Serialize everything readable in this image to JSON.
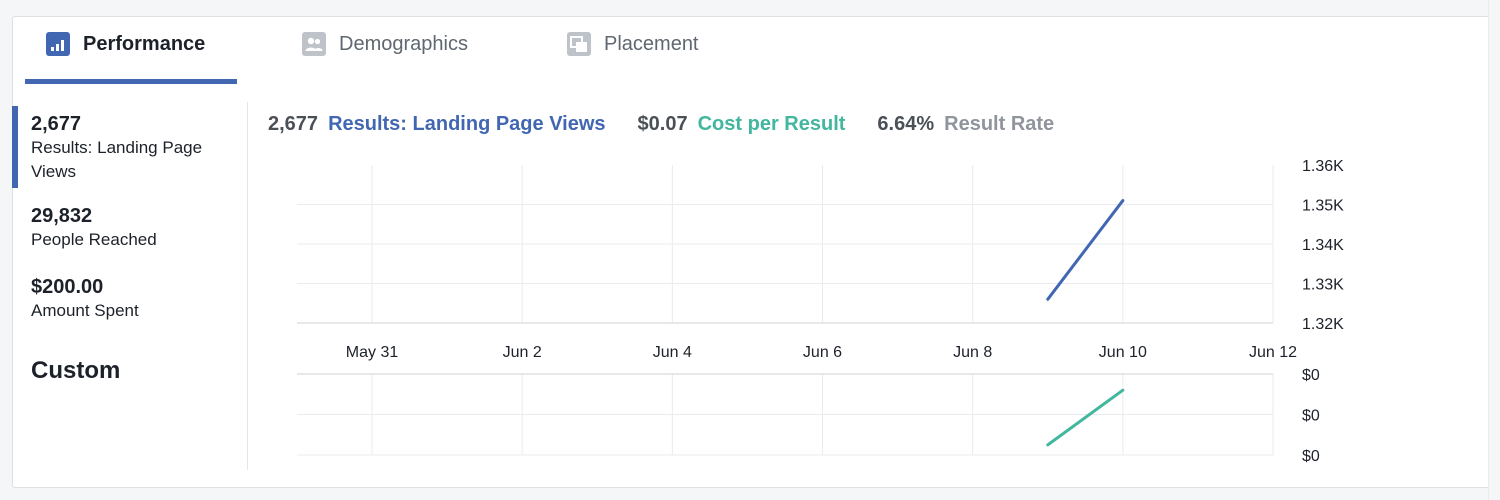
{
  "tabs": [
    {
      "label": "Performance",
      "icon": "bar-chart-icon",
      "active": true
    },
    {
      "label": "Demographics",
      "icon": "people-icon",
      "active": false
    },
    {
      "label": "Placement",
      "icon": "placement-icon",
      "active": false
    }
  ],
  "sidebar": {
    "metrics": [
      {
        "value": "2,677",
        "label": "Results: Landing Page Views",
        "active": true
      },
      {
        "value": "29,832",
        "label": "People Reached",
        "active": false
      },
      {
        "value": "$200.00",
        "label": "Amount Spent",
        "active": false
      }
    ],
    "custom_label": "Custom"
  },
  "summary": {
    "results_value": "2,677",
    "results_label": "Results: Landing Page Views",
    "cost_value": "$0.07",
    "cost_label": "Cost per Result",
    "rate_value": "6.64%",
    "rate_label": "Result Rate"
  },
  "colors": {
    "accent": "#4267b2",
    "results_series": "#4267b2",
    "cost_series": "#42b69e",
    "rate_label": "#90949c"
  },
  "chart_data": [
    {
      "type": "line",
      "x_tick_labels": [
        "May 31",
        "Jun 2",
        "Jun 4",
        "Jun 6",
        "Jun 8",
        "Jun 10",
        "Jun 12"
      ],
      "y_tick_labels": [
        "1.36K",
        "1.35K",
        "1.34K",
        "1.33K",
        "1.32K"
      ],
      "ylim": [
        1320,
        1360
      ],
      "grid": true,
      "series": [
        {
          "color": "#4267b2",
          "x": [
            "Jun 9",
            "Jun 10"
          ],
          "y": [
            1326,
            1351
          ]
        }
      ]
    },
    {
      "type": "line",
      "y_tick_labels": [
        "$0",
        "$0",
        "$0"
      ],
      "ylim": [
        0,
        1
      ],
      "grid": true,
      "series": [
        {
          "color": "#42b69e",
          "x": [
            "Jun 9",
            "Jun 10"
          ],
          "y": [
            0.25,
            1.6
          ]
        }
      ]
    }
  ]
}
